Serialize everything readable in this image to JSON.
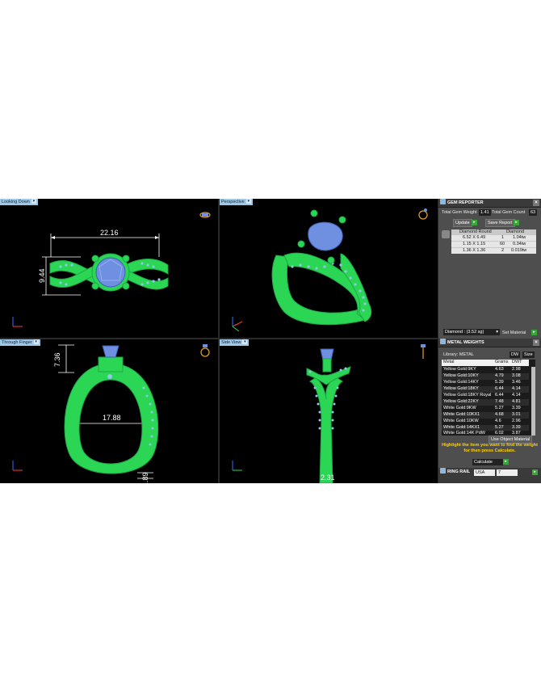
{
  "viewports": {
    "top_left": {
      "label": "Looking Down",
      "dims": {
        "width": "22.16",
        "height": "9.44"
      }
    },
    "top_right": {
      "label": "Perspective"
    },
    "bottom_left": {
      "label": "Through Finger",
      "dims": {
        "head": "7.36",
        "inner": "17.88",
        "shank": "1.89"
      }
    },
    "bottom_right": {
      "label": "Side View",
      "dims": {
        "width": "2.31"
      }
    }
  },
  "gem_reporter": {
    "title": "GEM REPORTER",
    "total_weight_label": "Total Gem Weight",
    "total_weight_value": "1.41",
    "total_count_label": "Total Gem Count",
    "total_count_value": "63",
    "update_label": "Update",
    "save_label": "Save Report",
    "col_shape": "Diamond Round",
    "col_material": "Diamond",
    "rows": [
      {
        "size": "6.52 X 6.49",
        "count": "1",
        "weight": "1.04tw"
      },
      {
        "size": "1.15 X 1.15",
        "count": "60",
        "weight": "0.34tw"
      },
      {
        "size": "1.36 X 1.36",
        "count": "2",
        "weight": "0.019tw"
      }
    ],
    "material_select": "Diamond : (3.52 sg)",
    "set_material_label": "Set Material"
  },
  "metal_weights": {
    "title": "METAL WEIGHTS",
    "library_label": "Library: METAL",
    "unit_select": "DW",
    "size_select": "Size",
    "col_metal": "Metal",
    "col_grams": "Grams",
    "col_dwt": "DWT",
    "rows": [
      {
        "metal": "Yellow Gold:9KY",
        "grams": "4.63",
        "dwt": "2.98"
      },
      {
        "metal": "Yellow Gold:10KY",
        "grams": "4.79",
        "dwt": "3.08"
      },
      {
        "metal": "Yellow Gold:14KY",
        "grams": "5.39",
        "dwt": "3.46"
      },
      {
        "metal": "Yellow Gold:18KY",
        "grams": "6.44",
        "dwt": "4.14"
      },
      {
        "metal": "Yellow Gold:18KY Royal",
        "grams": "6.44",
        "dwt": "4.14"
      },
      {
        "metal": "Yellow Gold:22KY",
        "grams": "7.48",
        "dwt": "4.81"
      },
      {
        "metal": "White Gold:9KW",
        "grams": "5.27",
        "dwt": "3.39"
      },
      {
        "metal": "White Gold:10KX1",
        "grams": "4.68",
        "dwt": "3.01"
      },
      {
        "metal": "White Gold:10KW",
        "grams": "4.6",
        "dwt": "2.96"
      },
      {
        "metal": "White Gold:14KX1",
        "grams": "5.27",
        "dwt": "3.39"
      },
      {
        "metal": "White Gold:14K PdW",
        "grams": "6.02",
        "dwt": "3.87"
      }
    ],
    "use_object_label": "Use Object Material",
    "hint_text": "Highlight the item you want to find the weight for then press Calculate.",
    "calculate_label": "Calculate"
  },
  "ring_rail": {
    "title": "RING RAIL",
    "region_select": "USA",
    "size_select": "7"
  },
  "colors": {
    "metal": "#2bd655",
    "gem": "#6f8fe0",
    "accent_blue": "#9fc7e6",
    "hint": "#ffd200"
  },
  "icons": [
    "ring-view-icon",
    "axis-gizmo-icon",
    "close-icon",
    "gem-icon",
    "dropdown-arrow-icon"
  ]
}
